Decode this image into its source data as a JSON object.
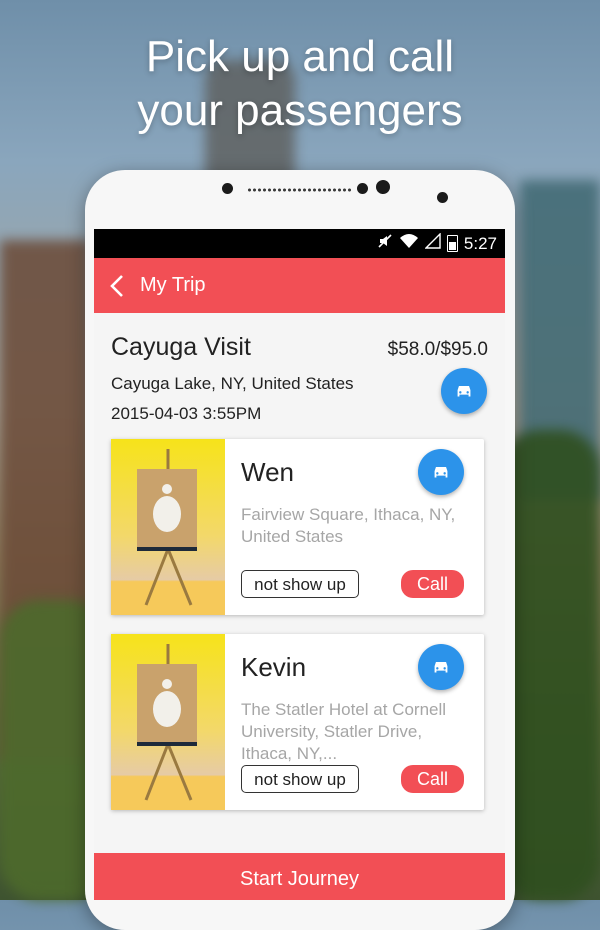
{
  "headline": {
    "line1": "Pick up and call",
    "line2": "your passengers"
  },
  "status_bar": {
    "time": "5:27",
    "icons": [
      "mute-icon",
      "wifi-icon",
      "signal-icon",
      "battery-icon"
    ]
  },
  "app_bar": {
    "title": "My Trip",
    "back_icon": "chevron-left-icon"
  },
  "trip": {
    "name": "Cayuga Visit",
    "price": "$58.0/$95.0",
    "location": "Cayuga Lake, NY, United States",
    "datetime": "2015-04-03  3:55PM"
  },
  "passengers": [
    {
      "name": "Wen",
      "address": "Fairview Square, Ithaca, NY, United States",
      "no_show_label": "not show up",
      "call_label": "Call"
    },
    {
      "name": "Kevin",
      "address": "The Statler Hotel at Cornell University, Statler Drive, Ithaca, NY,...",
      "no_show_label": "not show up",
      "call_label": "Call"
    }
  ],
  "start_button": {
    "label": "Start Journey"
  },
  "colors": {
    "accent": "#f24f55",
    "fab": "#2c93ea"
  }
}
